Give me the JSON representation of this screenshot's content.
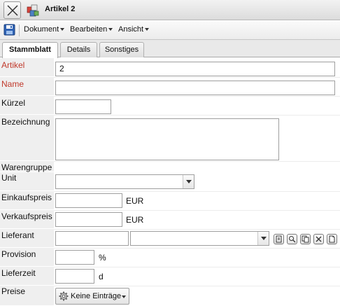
{
  "window": {
    "title": "Artikel 2"
  },
  "menu": {
    "items": [
      "Dokument",
      "Bearbeiten",
      "Ansicht"
    ]
  },
  "tabs": [
    {
      "label": "Stammblatt",
      "active": true
    },
    {
      "label": "Details",
      "active": false
    },
    {
      "label": "Sonstiges",
      "active": false
    }
  ],
  "fields": {
    "artikel": {
      "label": "Artikel",
      "value": "2"
    },
    "name": {
      "label": "Name",
      "value": ""
    },
    "kuerzel": {
      "label": "Kürzel",
      "value": ""
    },
    "bezeichnung": {
      "label": "Bezeichnung",
      "value": ""
    },
    "warengruppe": {
      "label": "Warengruppe"
    },
    "unit": {
      "label": "Unit",
      "value": ""
    },
    "einkaufspreis": {
      "label": "Einkaufspreis",
      "value": "",
      "unit": "EUR"
    },
    "verkaufspreis": {
      "label": "Verkaufspreis",
      "value": "",
      "unit": "EUR"
    },
    "lieferant": {
      "label": "Lieferant",
      "value": ""
    },
    "provision": {
      "label": "Provision",
      "value": "",
      "unit": "%"
    },
    "lieferzeit": {
      "label": "Lieferzeit",
      "value": "",
      "unit": "d"
    },
    "preise": {
      "label": "Preise",
      "button_label": "Keine Einträge"
    }
  },
  "colors": {
    "required_label": "#c0392b",
    "label_background": "#efefef"
  },
  "icons": {
    "close": "close-icon",
    "app": "articles-app-icon",
    "save": "save-icon",
    "lieferant_actions": [
      "open-detail-icon",
      "search-icon",
      "copy-icon",
      "clear-icon",
      "new-document-icon"
    ],
    "preise": "gear-icon"
  }
}
